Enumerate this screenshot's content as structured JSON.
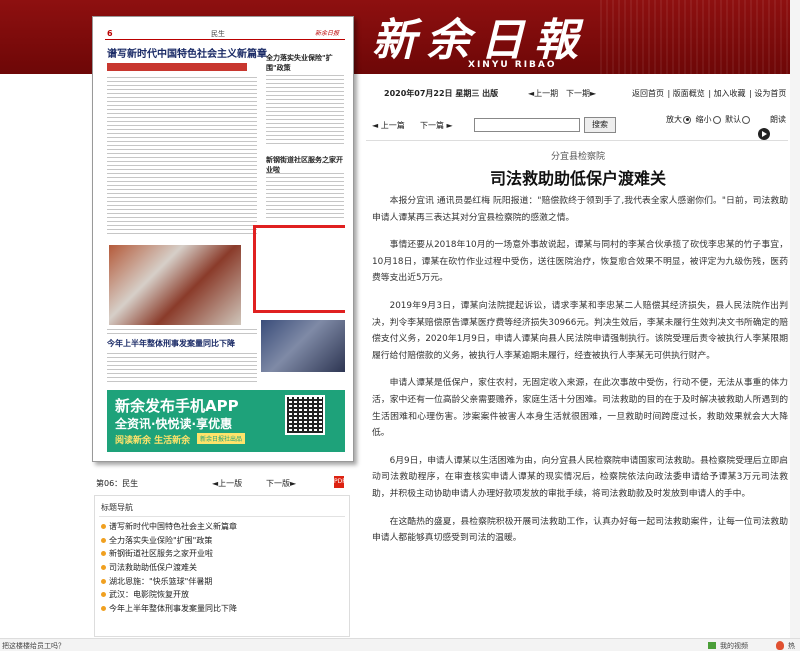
{
  "masthead": {
    "title_cn": "新余日報",
    "title_en": "XINYU RIBAO"
  },
  "thumbnail": {
    "page_number": "6",
    "page_name": "民生",
    "paper_logo": "新余日报",
    "headline_main": "谱写新时代中国特色社会主义新篇章",
    "headline_side1": "全力落实失业保险\"扩围\"政策",
    "headline_side2": "新钢街道社区服务之家开业啦",
    "highlighted_story": "司法救助助低保户渡难关",
    "headline_bottom": "今年上半年整体刑事发案量同比下降",
    "ad_line1": "新余发布手机APP",
    "ad_line2": "全资讯·快悦读·享优惠",
    "ad_line3": "阅读新余 生活新余",
    "ad_badge": "新余日报社出品"
  },
  "page_nav": {
    "label": "第06：民生",
    "prev": "◄上一版",
    "next": "下一版►",
    "pdf_icon": "pdf-icon"
  },
  "title_nav": {
    "heading": "标题导航",
    "items": [
      "谱写新时代中国特色社会主义新篇章",
      "全力落实失业保险\"扩围\"政策",
      "新钢街道社区服务之家开业啦",
      "司法救助助低保户渡难关",
      "湖北恩施：\"快乐篮球\"伴暑期",
      "武汉：电影院恢复开放",
      "今年上半年整体刑事发案量同比下降"
    ]
  },
  "dateline": {
    "date": "2020年07月22日 星期三 出版",
    "prev": "◄上一期",
    "next": "下一期►",
    "links": [
      "返回首页",
      "版面概览",
      "加入收藏",
      "设为首页"
    ]
  },
  "toolbar": {
    "prev": "◄ 上一篇",
    "next": "下一篇 ►",
    "search_value": "",
    "search_button": "搜索",
    "zoom_in": "放大",
    "zoom_out": "缩小",
    "zoom_default": "默认",
    "listen": "朗读"
  },
  "article": {
    "kicker": "分宜县检察院",
    "headline": "司法救助助低保户渡难关",
    "paragraphs": [
      "本报分宜讯 通讯员晏红梅 阮阳报道：\"赔偿款终于领到手了,我代表全家人感谢你们。\"日前，司法救助申请人谭某再三表达其对分宜县检察院的感激之情。",
      "事情还要从2018年10月的一场意外事故说起，谭某与同村的李某合伙承揽了砍伐李忠某的竹子事宜，10月18日，谭某在砍竹作业过程中受伤，送往医院治疗，恢复愈合效果不明显，被评定为九级伤残，医药费等支出近5万元。",
      "2019年9月3日，谭某向法院提起诉讼，请求李某和李忠某二人赔偿其经济损失，县人民法院作出判决，判令李某赔偿原告谭某医疗费等经济损失30966元。判决生效后，李某未履行生效判决文书所确定的赔偿支付义务，2020年1月9日，申请人谭某向县人民法院申请强制执行。该院受理后责令被执行人李某限期履行给付赔偿款的义务，被执行人李某逾期未履行，经查被执行人李某无可供执行财产。",
      "申请人谭某是低保户，家住农村，无固定收入来源，在此次事故中受伤，行动不便，无法从事重的体力活，家中还有一位高龄父亲需要赡养，家庭生活十分困难。司法救助的目的在于及时解决被救助人所遇到的生活困难和心理伤害。涉案案件被害人本身生活就很困难，一旦救助时间跨度过长，救助效果就会大大降低。",
      "6月9日，申请人谭某以生活困难为由，向分宜县人民检察院申请国家司法救助。县检察院受理后立即启动司法救助程序，在审查核实申请人谭某的现实情况后，检察院依法向政法委申请给予谭某3万元司法救助，并积极主动协助申请人办理好款项发放的审批手续，将司法救助款及时发放到申请人的手中。",
      "在这酷热的盛夏，县检察院积极开展司法救助工作，认真办好每一起司法救助案件，让每一位司法救助申请人都能够真切感受到司法的温暖。"
    ]
  },
  "statusbar": {
    "text": "把这楼楼给员工吗？",
    "video": "我的视频",
    "hot": "热"
  }
}
